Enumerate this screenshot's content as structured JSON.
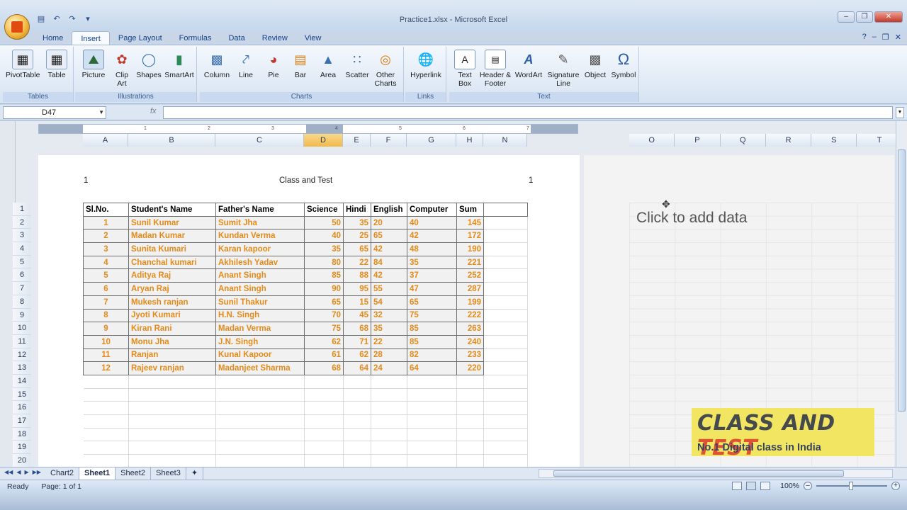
{
  "window": {
    "title": "Practice1.xlsx - Microsoft Excel"
  },
  "tabs": [
    "Home",
    "Insert",
    "Page Layout",
    "Formulas",
    "Data",
    "Review",
    "View"
  ],
  "ribbon": {
    "groups": {
      "tables": "Tables",
      "illustrations": "Illustrations",
      "charts": "Charts",
      "links": "Links",
      "text": "Text"
    },
    "buttons": {
      "pivottable": "PivotTable",
      "table": "Table",
      "picture": "Picture",
      "clipart": "Clip Art",
      "shapes": "Shapes",
      "smartart": "SmartArt",
      "column": "Column",
      "line": "Line",
      "pie": "Pie",
      "bar": "Bar",
      "area": "Area",
      "scatter": "Scatter",
      "other": "Other Charts",
      "hyperlink": "Hyperlink",
      "textbox": "Text Box",
      "header": "Header & Footer",
      "wordart": "WordArt",
      "signature": "Signature Line",
      "object": "Object",
      "symbol": "Symbol"
    }
  },
  "formula_bar": {
    "name_box": "D47",
    "fx": "fx",
    "formula": ""
  },
  "ruler_ticks": [
    "1",
    "2",
    "3",
    "4",
    "5",
    "6",
    "7"
  ],
  "columns_left": [
    {
      "label": "A",
      "w": 64
    },
    {
      "label": "B",
      "w": 123
    },
    {
      "label": "C",
      "w": 125
    },
    {
      "label": "D",
      "w": 55,
      "sel": true
    },
    {
      "label": "E",
      "w": 39
    },
    {
      "label": "F",
      "w": 51
    },
    {
      "label": "G",
      "w": 70
    },
    {
      "label": "H",
      "w": 38
    },
    {
      "label": "N",
      "w": 62
    }
  ],
  "columns_right": [
    "O",
    "P",
    "Q",
    "R",
    "S",
    "T"
  ],
  "page_header": {
    "left": "1",
    "center": "Class and Test",
    "right": "1"
  },
  "row_numbers": [
    "1",
    "2",
    "3",
    "4",
    "5",
    "6",
    "7",
    "8",
    "9",
    "10",
    "11",
    "12",
    "13",
    "14",
    "15",
    "16",
    "17",
    "18",
    "19",
    "20"
  ],
  "table": {
    "headers": [
      "Sl.No.",
      "Student's Name",
      "Father's Name",
      "Science",
      "Hindi",
      "English",
      "Computer",
      "Sum"
    ],
    "rows": [
      [
        "1",
        "Sunil Kumar",
        "Sumit Jha",
        "50",
        "35",
        "20",
        "40",
        "145"
      ],
      [
        "2",
        "Madan Kumar",
        "Kundan Verma",
        "40",
        "25",
        "65",
        "42",
        "172"
      ],
      [
        "3",
        "Sunita Kumari",
        "Karan kapoor",
        "35",
        "65",
        "42",
        "48",
        "190"
      ],
      [
        "4",
        "Chanchal kumari",
        "Akhilesh Yadav",
        "80",
        "22",
        "84",
        "35",
        "221"
      ],
      [
        "5",
        "Aditya Raj",
        "Anant Singh",
        "85",
        "88",
        "42",
        "37",
        "252"
      ],
      [
        "6",
        "Aryan Raj",
        "Anant Singh",
        "90",
        "95",
        "55",
        "47",
        "287"
      ],
      [
        "7",
        "Mukesh ranjan",
        "Sunil Thakur",
        "65",
        "15",
        "54",
        "65",
        "199"
      ],
      [
        "8",
        "Jyoti Kumari",
        "H.N. Singh",
        "70",
        "45",
        "32",
        "75",
        "222"
      ],
      [
        "9",
        "Kiran Rani",
        "Madan Verma",
        "75",
        "68",
        "35",
        "85",
        "263"
      ],
      [
        "10",
        "Monu Jha",
        "J.N. Singh",
        "62",
        "71",
        "22",
        "85",
        "240"
      ],
      [
        "11",
        "Ranjan",
        "Kunal Kapoor",
        "61",
        "62",
        "28",
        "82",
        "233"
      ],
      [
        "12",
        "Rajeev ranjan",
        "Madanjeet Sharma",
        "68",
        "64",
        "24",
        "64",
        "220"
      ]
    ],
    "empty_rows": 7
  },
  "chart_placeholder": "Click to add data",
  "brand": {
    "line1a": "CLASS AND ",
    "line1b": "TEST",
    "line2": "No.1 Digital class in India"
  },
  "sheets": [
    "Chart2",
    "Sheet1",
    "Sheet2",
    "Sheet3"
  ],
  "active_sheet": "Sheet1",
  "status": {
    "ready": "Ready",
    "page": "Page: 1 of 1",
    "zoom": "100%"
  }
}
